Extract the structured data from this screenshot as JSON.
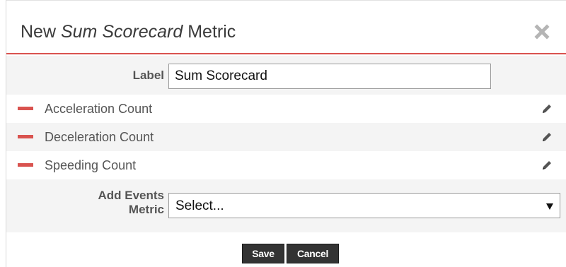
{
  "dialog": {
    "title_prefix": "New ",
    "title_italic": "Sum Scorecard",
    "title_suffix": " Metric",
    "close_icon": "close-icon"
  },
  "form": {
    "label_field": {
      "label": "Label",
      "value": "Sum Scorecard"
    },
    "metrics": [
      {
        "name": "Acceleration Count",
        "remove_icon": "minus-icon",
        "edit_icon": "pencil-icon"
      },
      {
        "name": "Deceleration Count",
        "remove_icon": "minus-icon",
        "edit_icon": "pencil-icon"
      },
      {
        "name": "Speeding Count",
        "remove_icon": "minus-icon",
        "edit_icon": "pencil-icon"
      }
    ],
    "add_events": {
      "label_line1": "Add Events",
      "label_line2": "Metric",
      "selected": "Select..."
    }
  },
  "buttons": {
    "save": "Save",
    "cancel": "Cancel"
  },
  "colors": {
    "accent_red": "#d9534f",
    "button_dark": "#333333",
    "row_grey": "#f4f4f4"
  }
}
